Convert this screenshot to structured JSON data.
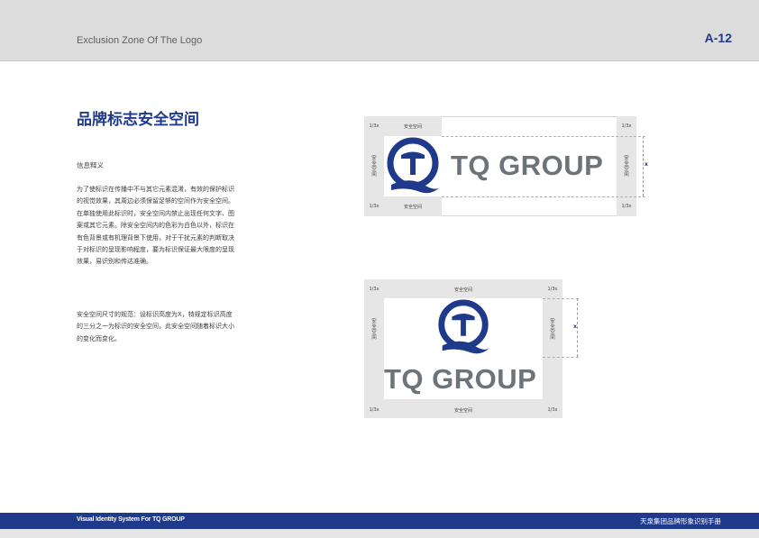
{
  "header": {
    "title": "Exclusion Zone Of The Logo",
    "page": "A-12"
  },
  "section": {
    "title": "品牌标志安全空间",
    "sub_head": "信息释义",
    "para1": "为了使标识在传播中不与其它元素混淆，有效的保护标识的视觉效果，其周边必须保留足够的空间作为安全空间。在单独使用此标识时，安全空间内禁止出现任何文字、图案或其它元素。除安全空间内的色彩为白色以外，标识在有色背景或有机理背景下使用，对于干扰元素的判断取决于对标识的呈现影响程度，要为标识保证最大限度的呈现效果，易识别和传达准确。",
    "para2": "安全空间尺寸的规范：设标识高度为X，特规定标识高度的三分之一为标识的安全空间，此安全空间随着标识大小的变化而变化。"
  },
  "diagram": {
    "fraction": "1/3x",
    "zone_label": "安全空间",
    "x_mark": "x",
    "logo_text": "TQ GROUP"
  },
  "colors": {
    "brand_blue": "#1f3a8a",
    "logo_gray": "#6c7479",
    "zone_gray": "#e6e6e6"
  },
  "footer": {
    "left": "Visual Identity System For TQ GROUP",
    "right": "天泉集团品牌形象识别手册"
  }
}
